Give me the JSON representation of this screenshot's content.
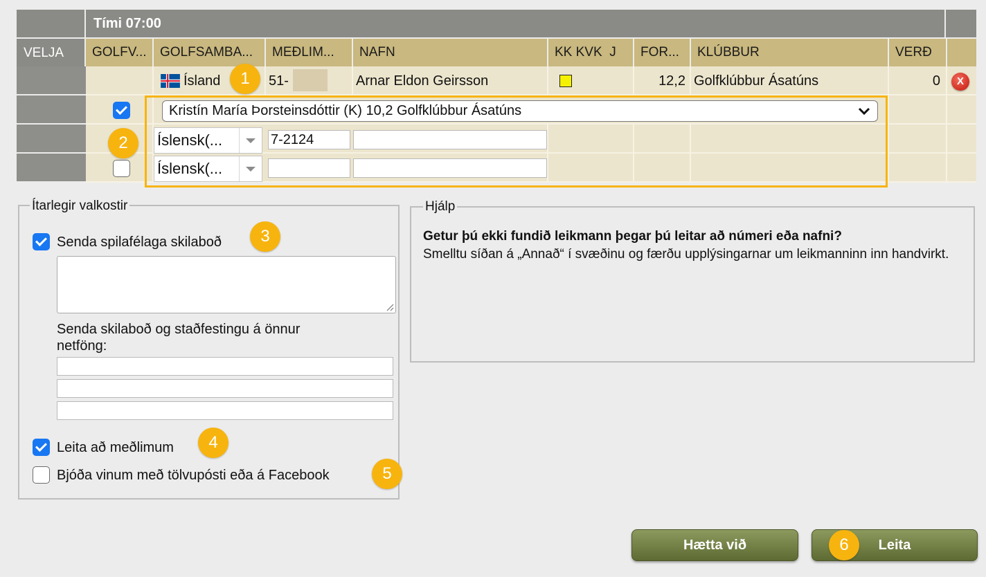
{
  "grid": {
    "time_label": "Tími 07:00",
    "headers": {
      "velja": "VELJA",
      "golfv": "GOLFV...",
      "golfsamband": "GOLFSAMBA...",
      "medlimur": "MEÐLIM...",
      "nafn": "NAFN",
      "kk_kvk_j": "KK KVK  J",
      "forgjof": "FOR...",
      "klubbur": "KLÚBBUR",
      "verd": "VERÐ"
    },
    "row1": {
      "country": "Ísland",
      "member_no": "51-",
      "name": "Arnar Eldon Geirsson",
      "handicap": "12,2",
      "club": "Golfklúbbur Ásatúns",
      "price": "0"
    },
    "row2": {
      "selected_player": "Kristín María Þorsteinsdóttir (K) 10,2 Golfklúbbur Ásatúns"
    },
    "row3": {
      "federation": "Íslensk(...",
      "member_no": "7-2124",
      "name": ""
    },
    "row4": {
      "federation": "Íslensk(...",
      "member_no": "",
      "name": ""
    }
  },
  "badges": [
    "1",
    "2",
    "3",
    "4",
    "5",
    "6"
  ],
  "options": {
    "legend": "Ítarlegir valkostir",
    "send_message_label": "Senda spilafélaga skilaboð",
    "send_message_checked": true,
    "message_text": "",
    "other_emails_label": "Senda skilaboð og staðfestingu á önnur netföng:",
    "emails": [
      "",
      "",
      ""
    ],
    "search_members_label": "Leita að meðlimum",
    "search_members_checked": true,
    "invite_friends_label": "Bjóða vinum með tölvupósti eða á Facebook",
    "invite_friends_checked": false
  },
  "help": {
    "legend": "Hjálp",
    "title": "Getur þú ekki fundið leikmann þegar þú leitar að númeri eða nafni?",
    "text": "Smelltu síðan á „Annað“ í svæðinu og færðu upplýsingarnar um leikmanninn inn handvirkt."
  },
  "buttons": {
    "cancel": "Hætta við",
    "search": "Leita"
  },
  "colors": {
    "header_gold": "#c9b87f",
    "row_beige": "#ece5cd",
    "highlight_border": "#f7b40f",
    "button_green": "#6f7d41"
  }
}
